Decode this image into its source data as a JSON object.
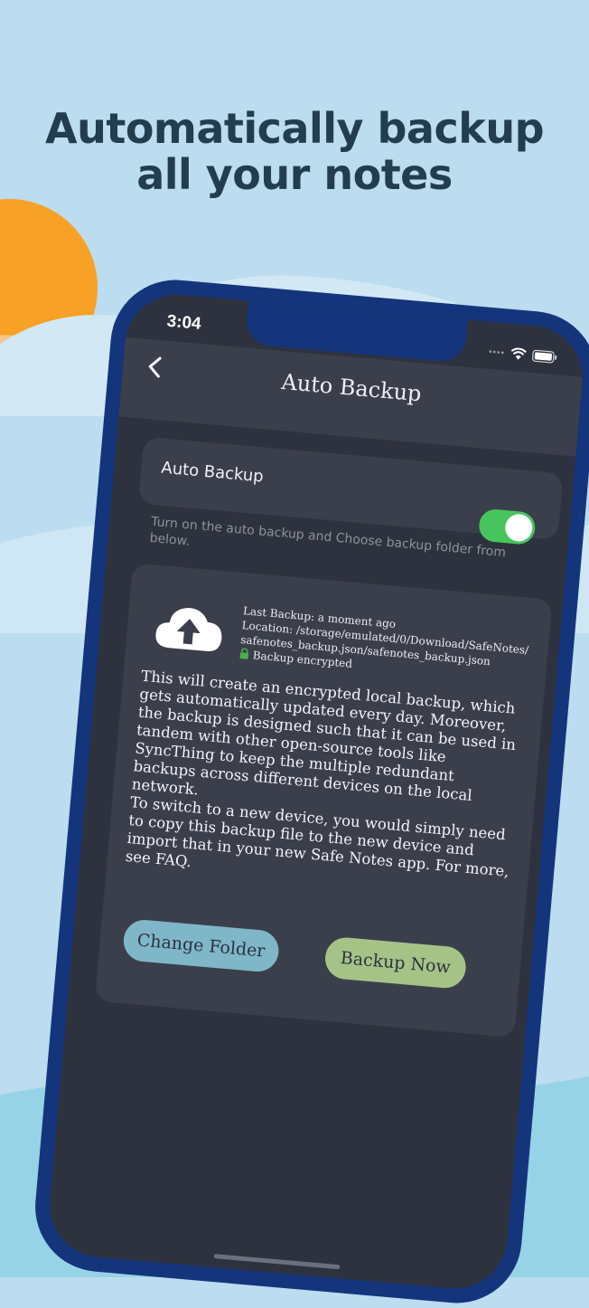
{
  "headline": {
    "line1": "Automatically backup",
    "line2": "all your notes"
  },
  "colors": {
    "background": "#bcdcf0",
    "sun": "#f7a126",
    "phone_frame": "#14357c",
    "screen": "#2e323e",
    "card": "#3b3f4c",
    "toggle_on": "#47c45d",
    "change_folder": "#7fb7c8",
    "backup_now": "#a5c387",
    "lock": "#4caf50"
  },
  "status_bar": {
    "time": "3:04",
    "icons": [
      "signal-dots",
      "wifi-icon",
      "battery-icon"
    ]
  },
  "app_bar": {
    "title": "Auto Backup",
    "back_icon": "chevron-left-icon"
  },
  "auto_backup": {
    "label": "Auto Backup",
    "enabled": true,
    "hint": "Turn on the auto backup and Choose backup folder from below."
  },
  "backup_info": {
    "icon": "cloud-upload-icon",
    "last_backup": "Last Backup: a moment ago",
    "location_line1": "Location: /storage/emulated/0/Download/SafeNotes/",
    "location_line2": "safenotes_backup.json/safenotes_backup.json",
    "encrypted_label": "Backup encrypted",
    "description_p1": "This will create an encrypted local backup, which gets automatically updated every day. Moreover, the backup is designed such that it can be used in tandem with other open-source tools like SyncThing to keep the multiple redundant backups across different devices on the local network.",
    "description_p2": "To switch to a new device, you would simply need to copy this backup file to the new device and import that in your new Safe Notes app. For more, see FAQ."
  },
  "buttons": {
    "change_folder": "Change Folder",
    "backup_now": "Backup Now"
  }
}
